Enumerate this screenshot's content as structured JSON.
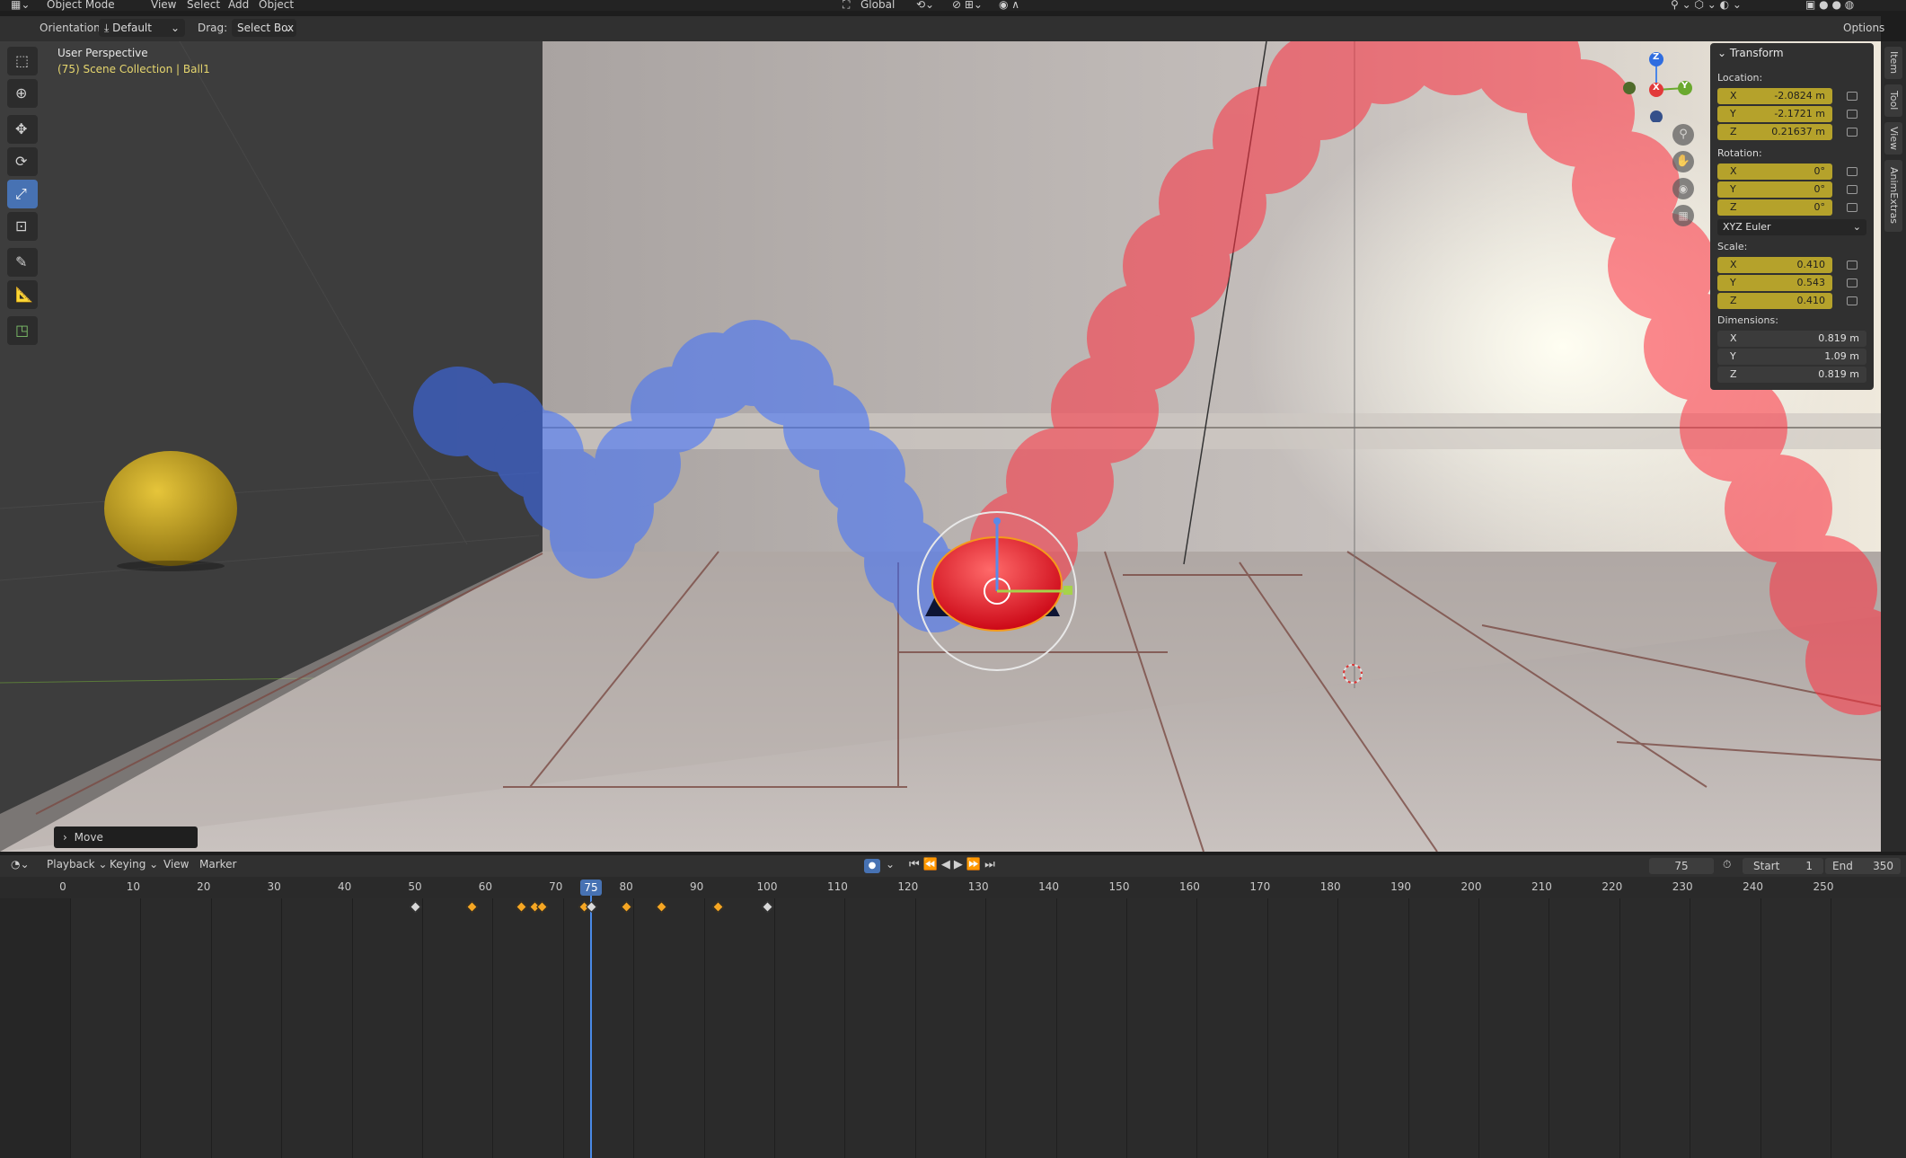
{
  "menubar": {
    "items": [
      "Object Mode",
      "View",
      "Select",
      "Add",
      "Object"
    ],
    "transform_orientation": "Global",
    "options_label": "Options"
  },
  "header": {
    "orientation_label": "Orientation:",
    "orientation_value": "Default",
    "drag_label": "Drag:",
    "drag_value": "Select Box"
  },
  "viewport": {
    "view_name": "User Perspective",
    "collection_info": "(75) Scene Collection | Ball1",
    "last_operator": "Move"
  },
  "right_tabs": [
    "Item",
    "Tool",
    "View",
    "AnimExtras"
  ],
  "transform_panel": {
    "title": "Transform",
    "location_label": "Location:",
    "location": [
      {
        "axis": "X",
        "value": "-2.0824 m"
      },
      {
        "axis": "Y",
        "value": "-2.1721 m"
      },
      {
        "axis": "Z",
        "value": "0.21637 m"
      }
    ],
    "rotation_label": "Rotation:",
    "rotation": [
      {
        "axis": "X",
        "value": "0°"
      },
      {
        "axis": "Y",
        "value": "0°"
      },
      {
        "axis": "Z",
        "value": "0°"
      }
    ],
    "rotation_mode": "XYZ Euler",
    "scale_label": "Scale:",
    "scale": [
      {
        "axis": "X",
        "value": "0.410"
      },
      {
        "axis": "Y",
        "value": "0.543"
      },
      {
        "axis": "Z",
        "value": "0.410"
      }
    ],
    "dimensions_label": "Dimensions:",
    "dimensions": [
      {
        "axis": "X",
        "value": "0.819 m"
      },
      {
        "axis": "Y",
        "value": "1.09 m"
      },
      {
        "axis": "Z",
        "value": "0.819 m"
      }
    ]
  },
  "gizmo": {
    "x": "X",
    "y": "Y",
    "z": "Z"
  },
  "timeline": {
    "menus": [
      "Playback",
      "Keying",
      "View",
      "Marker"
    ],
    "current_frame": "75",
    "start_label": "Start",
    "start_value": "1",
    "end_label": "End",
    "end_value": "350",
    "ruler_ticks": [
      "0",
      "10",
      "20",
      "30",
      "40",
      "50",
      "60",
      "70",
      "80",
      "90",
      "100",
      "110",
      "120",
      "130",
      "140",
      "150",
      "160",
      "170",
      "180",
      "190",
      "200",
      "210",
      "220",
      "230",
      "240",
      "250"
    ],
    "keyframes": [
      {
        "frame": 50,
        "selected": false
      },
      {
        "frame": 58,
        "selected": true
      },
      {
        "frame": 65,
        "selected": true
      },
      {
        "frame": 67,
        "selected": true
      },
      {
        "frame": 68,
        "selected": true
      },
      {
        "frame": 74,
        "selected": true
      },
      {
        "frame": 75,
        "selected": false
      },
      {
        "frame": 80,
        "selected": true
      },
      {
        "frame": 85,
        "selected": true
      },
      {
        "frame": 93,
        "selected": true
      },
      {
        "frame": 100,
        "selected": false
      }
    ]
  }
}
